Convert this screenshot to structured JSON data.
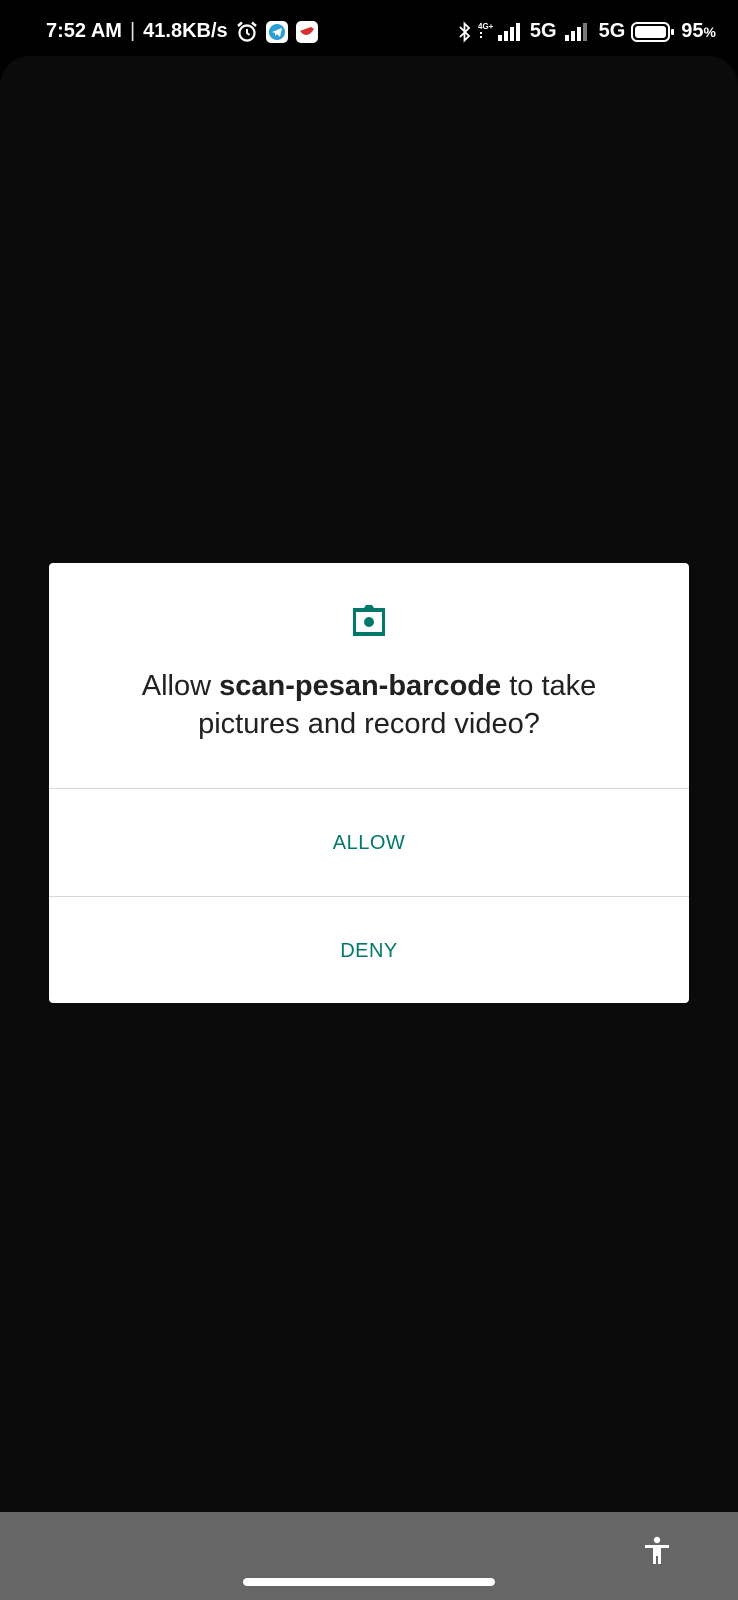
{
  "status_bar": {
    "time": "7:52 AM",
    "separator": "|",
    "net_speed": "41.8KB/s",
    "sim1_type_small": "4G+",
    "sim1_network": "5G",
    "sim2_network": "5G",
    "battery_percent": "95",
    "battery_unit": "%",
    "icons": [
      "alarm-icon",
      "telegram-icon",
      "app-notification-icon",
      "bluetooth-icon",
      "signal-icon",
      "battery-icon"
    ]
  },
  "dialog": {
    "message_prefix": "Allow ",
    "app_name": "scan-pesan-barcode",
    "message_suffix": " to take pictures and record video?",
    "icon": "camera-icon",
    "allow_label": "ALLOW",
    "deny_label": "DENY"
  },
  "nav": {
    "accessibility_icon": "accessibility-icon"
  },
  "colors": {
    "accent": "#00796b",
    "scrim": "#0b0b0b",
    "nav_bar": "#666666",
    "dialog_bg": "#ffffff",
    "text": "#212121"
  }
}
